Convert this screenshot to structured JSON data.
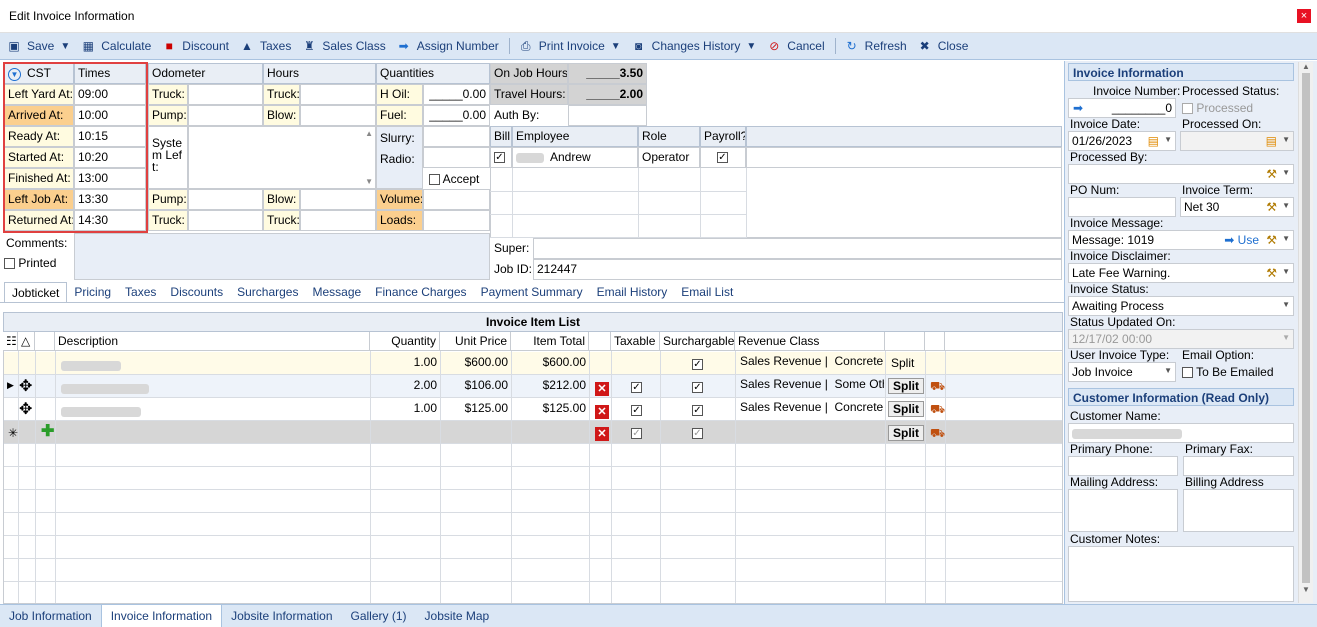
{
  "window": {
    "title": "Edit Invoice Information",
    "close": "×"
  },
  "toolbar": {
    "save": "Save",
    "calculate": "Calculate",
    "discount": "Discount",
    "taxes": "Taxes",
    "sales_class": "Sales Class",
    "assign_number": "Assign Number",
    "print_invoice": "Print Invoice",
    "changes_history": "Changes History",
    "cancel": "Cancel",
    "refresh": "Refresh",
    "close": "Close"
  },
  "times": {
    "tz": "CST",
    "header": "Times",
    "rows": [
      {
        "label": "Left Yard At:",
        "value": "09:00"
      },
      {
        "label": "Arrived At:",
        "value": "10:00"
      },
      {
        "label": "Ready At:",
        "value": "10:15"
      },
      {
        "label": "Started At:",
        "value": "10:20"
      },
      {
        "label": "Finished At:",
        "value": "13:00"
      },
      {
        "label": "Left Job At:",
        "value": "13:30"
      },
      {
        "label": "Returned At:",
        "value": "14:30"
      }
    ]
  },
  "odometer": {
    "header": "Odometer",
    "truck": "Truck:",
    "pump": "Pump:",
    "system_left": "System Left:",
    "pump2": "Pump:",
    "truck2": "Truck:"
  },
  "hours": {
    "header": "Hours",
    "truck": "Truck:",
    "blow": "Blow:",
    "blow2": "Blow:",
    "truck2": "Truck:"
  },
  "quantities": {
    "header": "Quantities",
    "h_oil": "H Oil:",
    "h_oil_val": "_____0.00",
    "fuel": "Fuel:",
    "fuel_val": "_____0.00",
    "slurry": "Slurry:",
    "radio": "Radio:",
    "accept": "Accept",
    "volume": "Volume:",
    "loads": "Loads:"
  },
  "job_hours": {
    "on_job_label": "On Job Hours:",
    "on_job_val": "_____3.50",
    "travel_label": "Travel Hours:",
    "travel_val": "_____2.00",
    "auth_by": "Auth By:"
  },
  "employees": {
    "headers": [
      "Bill",
      "Employee",
      "Role",
      "Payroll?"
    ],
    "rows": [
      {
        "bill": "✓",
        "name": "Andrew",
        "role": "Operator",
        "payroll": "✓"
      }
    ]
  },
  "super_label": "Super:",
  "job_id_label": "Job ID:",
  "job_id": "212447",
  "comments_label": "Comments:",
  "printed_label": "Printed",
  "tabs": [
    "Jobticket",
    "Pricing",
    "Taxes",
    "Discounts",
    "Surcharges",
    "Message",
    "Finance Charges",
    "Payment Summary",
    "Email History",
    "Email List"
  ],
  "item_list": {
    "title": "Invoice Item List",
    "headers": {
      "description": "Description",
      "quantity": "Quantity",
      "unit_price": "Unit Price",
      "item_total": "Item Total",
      "taxable": "Taxable",
      "surchargable": "Surchargable",
      "revenue_class": "Revenue Class"
    },
    "rows": [
      {
        "quantity": "1.00",
        "unit_price": "$600.00",
        "item_total": "$600.00",
        "revenue": "Sales Revenue |  Concrete",
        "split": "Split"
      },
      {
        "quantity": "2.00",
        "unit_price": "$106.00",
        "item_total": "$212.00",
        "revenue": "Sales Revenue |  Some Oth",
        "split": "Split"
      },
      {
        "quantity": "1.00",
        "unit_price": "$125.00",
        "item_total": "$125.00",
        "revenue": "Sales Revenue |  Concrete",
        "split": "Split"
      }
    ],
    "new_split": "Split"
  },
  "invoice_info": {
    "header": "Invoice Information",
    "invoice_number_label": "Invoice Number:",
    "invoice_number": "________0",
    "processed_status_label": "Processed Status:",
    "processed": "Processed",
    "invoice_date_label": "Invoice Date:",
    "invoice_date": "01/26/2023",
    "processed_on_label": "Processed On:",
    "processed_by_label": "Processed By:",
    "po_num_label": "PO Num:",
    "invoice_term_label": "Invoice Term:",
    "invoice_term": "Net 30",
    "invoice_message_label": "Invoice Message:",
    "invoice_message": "Message: 1019",
    "use": "Use",
    "disclaimer_label": "Invoice Disclaimer:",
    "disclaimer": "Late Fee Warning.",
    "status_label": "Invoice Status:",
    "status": "Awaiting Process",
    "status_updated_label": "Status Updated On:",
    "status_updated": "12/17/02 00:00",
    "user_type_label": "User Invoice Type:",
    "user_type": "Job Invoice",
    "email_option_label": "Email Option:",
    "to_be_emailed": "To Be Emailed"
  },
  "customer_info": {
    "header": "Customer Information (Read Only)",
    "name_label": "Customer Name:",
    "phone_label": "Primary Phone:",
    "fax_label": "Primary Fax:",
    "mailing_label": "Mailing Address:",
    "billing_label": "Billing Address",
    "notes_label": "Customer Notes:"
  },
  "bottom_tabs": [
    "Job Information",
    "Invoice Information",
    "Jobsite Information",
    "Gallery (1)",
    "Jobsite Map"
  ]
}
